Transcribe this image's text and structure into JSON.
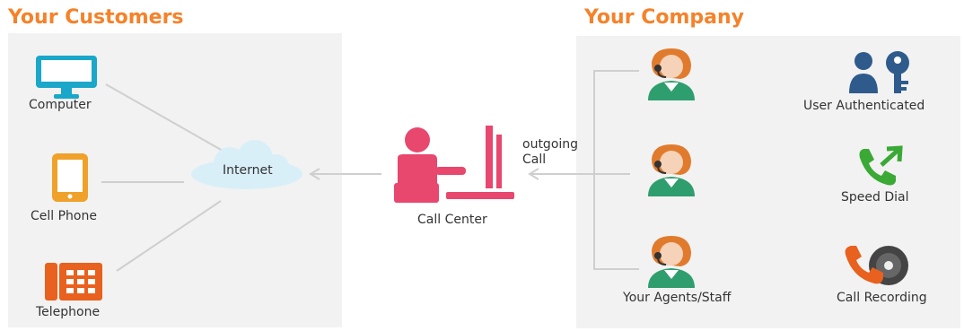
{
  "left_section": {
    "title": "Your Customers",
    "devices": [
      {
        "label": "Computer",
        "icon": "computer-icon",
        "color": "#1aa7c9"
      },
      {
        "label": "Cell Phone",
        "icon": "cell-phone-icon",
        "color": "#f0a12a"
      },
      {
        "label": "Telephone",
        "icon": "telephone-icon",
        "color": "#e8611e"
      }
    ],
    "hub": {
      "label": "Internet",
      "icon": "cloud-icon",
      "color": "#d9eff8"
    }
  },
  "center": {
    "label": "Call Center",
    "icon": "call-center-agent-icon",
    "color": "#e8476e",
    "arrow_label_line1": "outgoing",
    "arrow_label_line2": "Call"
  },
  "right_section": {
    "title": "Your Company",
    "agents_label": "Your Agents/Staff",
    "agent_icon": "headset-agent-icon",
    "features": [
      {
        "label": "User Authenticated",
        "icon": "user-key-icon",
        "color": "#2f5b8c"
      },
      {
        "label": "Speed Dial",
        "icon": "speed-dial-phone-icon",
        "color": "#3aa935"
      },
      {
        "label": "Call Recording",
        "icon": "call-recording-icon",
        "color": "#e8611e"
      }
    ]
  },
  "colors": {
    "heading": "#f5822a",
    "panel": "#f2f2f2",
    "connector": "#cfcfcf"
  }
}
